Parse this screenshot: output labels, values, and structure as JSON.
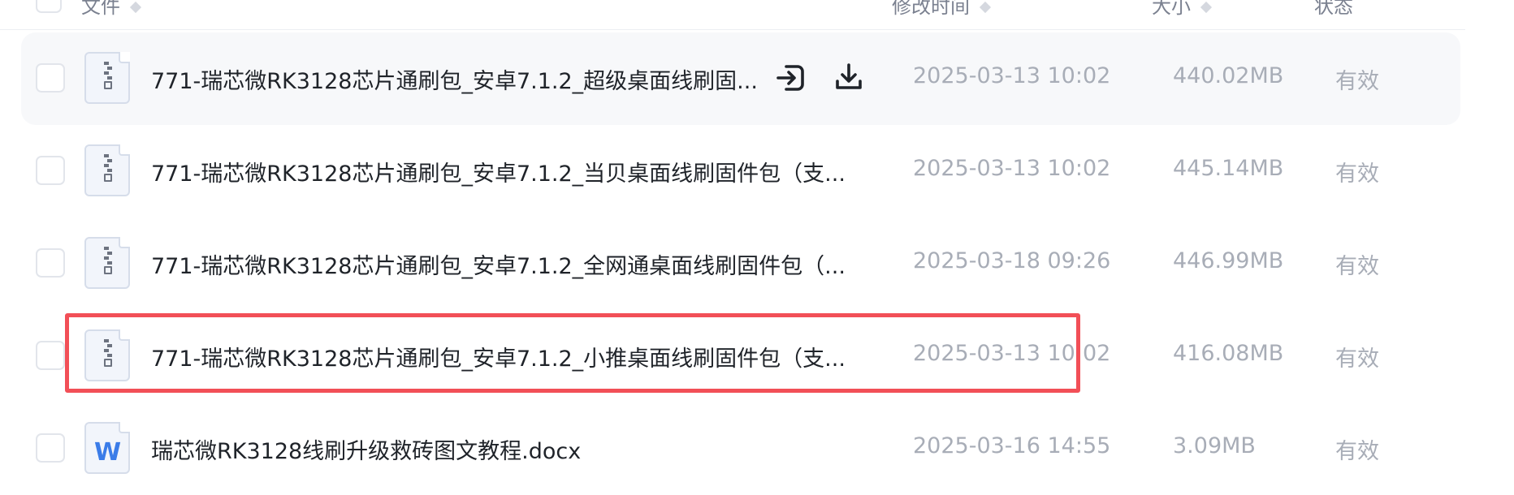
{
  "header": {
    "col_file": "文件",
    "col_modified": "修改时间",
    "col_size": "大小",
    "col_status": "状态"
  },
  "rows": [
    {
      "name": "771-瑞芯微RK3128芯片通刷包_安卓7.1.2_超级桌面线刷固...",
      "modified": "2025-03-13 10:02",
      "size": "440.02MB",
      "status": "有效",
      "icon": "zip-file-icon"
    },
    {
      "name": "771-瑞芯微RK3128芯片通刷包_安卓7.1.2_当贝桌面线刷固件包（支...",
      "modified": "2025-03-13 10:02",
      "size": "445.14MB",
      "status": "有效",
      "icon": "zip-file-icon"
    },
    {
      "name": "771-瑞芯微RK3128芯片通刷包_安卓7.1.2_全网通桌面线刷固件包（...",
      "modified": "2025-03-18 09:26",
      "size": "446.99MB",
      "status": "有效",
      "icon": "zip-file-icon"
    },
    {
      "name": "771-瑞芯微RK3128芯片通刷包_安卓7.1.2_小推桌面线刷固件包（支...",
      "modified": "2025-03-13 10:02",
      "size": "416.08MB",
      "status": "有效",
      "icon": "zip-file-icon"
    },
    {
      "name": "瑞芯微RK3128线刷升级救砖图文教程.docx",
      "modified": "2025-03-16 14:55",
      "size": "3.09MB",
      "status": "有效",
      "icon": "word-file-icon"
    }
  ],
  "word_icon_glyph": "W",
  "colors": {
    "highlight": "#f24f57",
    "row_hover": "#f7f8fa",
    "muted_text": "#a8adb7"
  }
}
